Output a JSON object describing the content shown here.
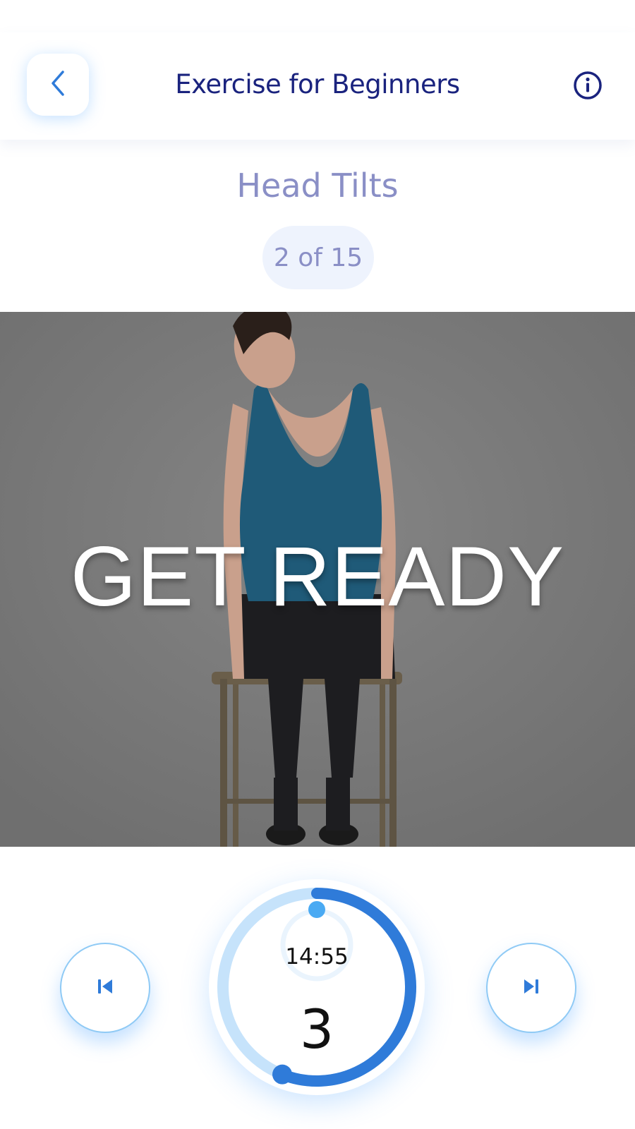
{
  "header": {
    "title": "Exercise for Beginners",
    "back_icon": "chevron-left-icon",
    "info_icon": "info-icon"
  },
  "exercise": {
    "name": "Head Tilts",
    "progress_text": "2 of 15",
    "current": 2,
    "total": 15
  },
  "media": {
    "overlay_text": "GET READY"
  },
  "timer": {
    "time_label": "14:55",
    "countdown": "3",
    "ring_progress": 0.56
  },
  "controls": {
    "previous_icon": "skip-previous-icon",
    "next_icon": "skip-next-icon"
  },
  "colors": {
    "title_navy": "#1a237e",
    "muted_purple": "#8a8fc6",
    "accent_blue": "#2f7bd9",
    "light_blue": "#c6e3fb",
    "pill_bg": "#eef3fd"
  }
}
